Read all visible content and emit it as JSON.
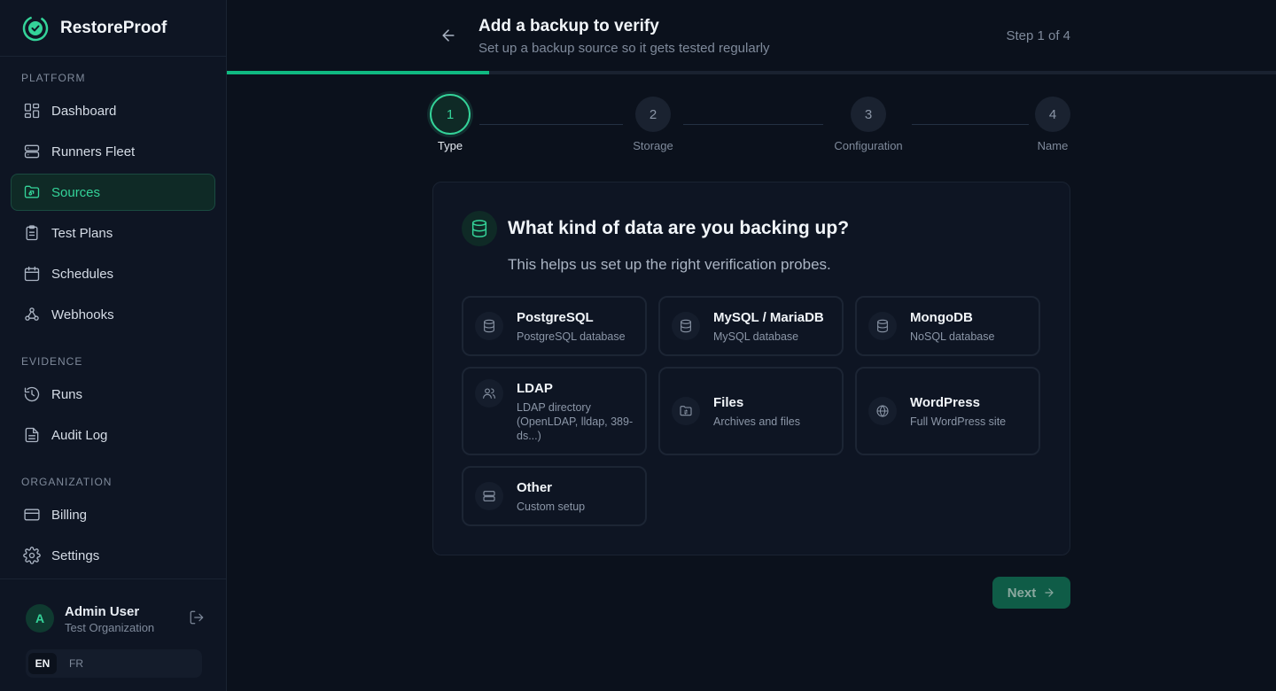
{
  "brand": {
    "name": "RestoreProof",
    "logo_icon": "check-circle-icon"
  },
  "sidebar": {
    "sections": [
      {
        "label": "PLATFORM",
        "items": [
          {
            "label": "Dashboard",
            "icon": "dashboard-icon"
          },
          {
            "label": "Runners Fleet",
            "icon": "server-icon"
          },
          {
            "label": "Sources",
            "icon": "folder-tree-icon",
            "active": true
          },
          {
            "label": "Test Plans",
            "icon": "clipboard-check-icon"
          },
          {
            "label": "Schedules",
            "icon": "calendar-icon"
          },
          {
            "label": "Webhooks",
            "icon": "webhook-icon"
          }
        ]
      },
      {
        "label": "EVIDENCE",
        "items": [
          {
            "label": "Runs",
            "icon": "history-icon"
          },
          {
            "label": "Audit Log",
            "icon": "file-text-icon"
          }
        ]
      },
      {
        "label": "ORGANIZATION",
        "items": [
          {
            "label": "Billing",
            "icon": "credit-card-icon"
          },
          {
            "label": "Settings",
            "icon": "gear-icon"
          }
        ]
      }
    ]
  },
  "user": {
    "initial": "A",
    "name": "Admin User",
    "org": "Test Organization"
  },
  "language": {
    "options": [
      "EN",
      "FR"
    ],
    "selected": "EN"
  },
  "header": {
    "title": "Add a backup to verify",
    "subtitle": "Set up a backup source so it gets tested regularly",
    "step_count": "Step 1 of 4",
    "progress_fraction": 0.25
  },
  "stepper": {
    "steps": [
      {
        "number": "1",
        "label": "Type",
        "active": true
      },
      {
        "number": "2",
        "label": "Storage"
      },
      {
        "number": "3",
        "label": "Configuration"
      },
      {
        "number": "4",
        "label": "Name"
      }
    ]
  },
  "card": {
    "icon": "database-icon",
    "title": "What kind of data are you backing up?",
    "description": "This helps us set up the right verification probes.",
    "options": [
      {
        "name": "PostgreSQL",
        "desc": "PostgreSQL database",
        "icon": "database-icon"
      },
      {
        "name": "MySQL / MariaDB",
        "desc": "MySQL database",
        "icon": "database-icon"
      },
      {
        "name": "MongoDB",
        "desc": "NoSQL database",
        "icon": "database-icon"
      },
      {
        "name": "LDAP",
        "desc": "LDAP directory (OpenLDAP, lldap, 389-ds...)",
        "icon": "users-icon"
      },
      {
        "name": "Files",
        "desc": "Archives and files",
        "icon": "folder-sync-icon"
      },
      {
        "name": "WordPress",
        "desc": "Full WordPress site",
        "icon": "globe-icon"
      },
      {
        "name": "Other",
        "desc": "Custom setup",
        "icon": "server-icon"
      }
    ]
  },
  "actions": {
    "next_label": "Next"
  }
}
